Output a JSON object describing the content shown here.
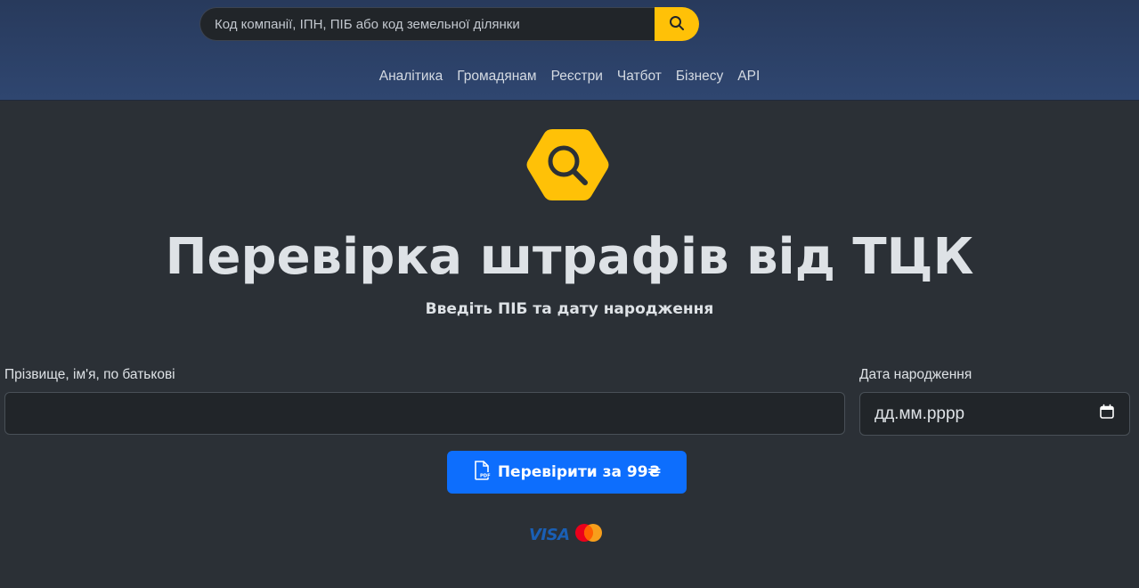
{
  "header": {
    "search": {
      "placeholder": "Код компанії, ІПН, ПІБ або код земельної ділянки",
      "button_icon": "search-icon"
    },
    "nav": [
      {
        "label": "Аналітика"
      },
      {
        "label": "Громадянам"
      },
      {
        "label": "Реєстри"
      },
      {
        "label": "Чатбот"
      },
      {
        "label": "Бізнесу"
      },
      {
        "label": "API"
      }
    ]
  },
  "hero": {
    "logo_icon": "magnifier-hexagon-logo",
    "title": "Перевірка штрафів від ТЦК",
    "subtitle": "Введіть ПІБ та дату народження"
  },
  "form": {
    "name_label": "Прізвище, ім'я, по батькові",
    "name_value": "",
    "date_label": "Дата народження",
    "date_placeholder": "дд.мм.рррр",
    "date_icon": "calendar-icon",
    "submit_label": "Перевірити за 99₴",
    "submit_icon": "pdf-file-icon"
  },
  "payments": {
    "visa_text": "VISA",
    "mastercard_icon": "mastercard-icon"
  },
  "colors": {
    "accent": "#ffc107",
    "primary": "#0d6efd",
    "header_bg": "#2f4670",
    "page_bg": "#2b3036"
  }
}
